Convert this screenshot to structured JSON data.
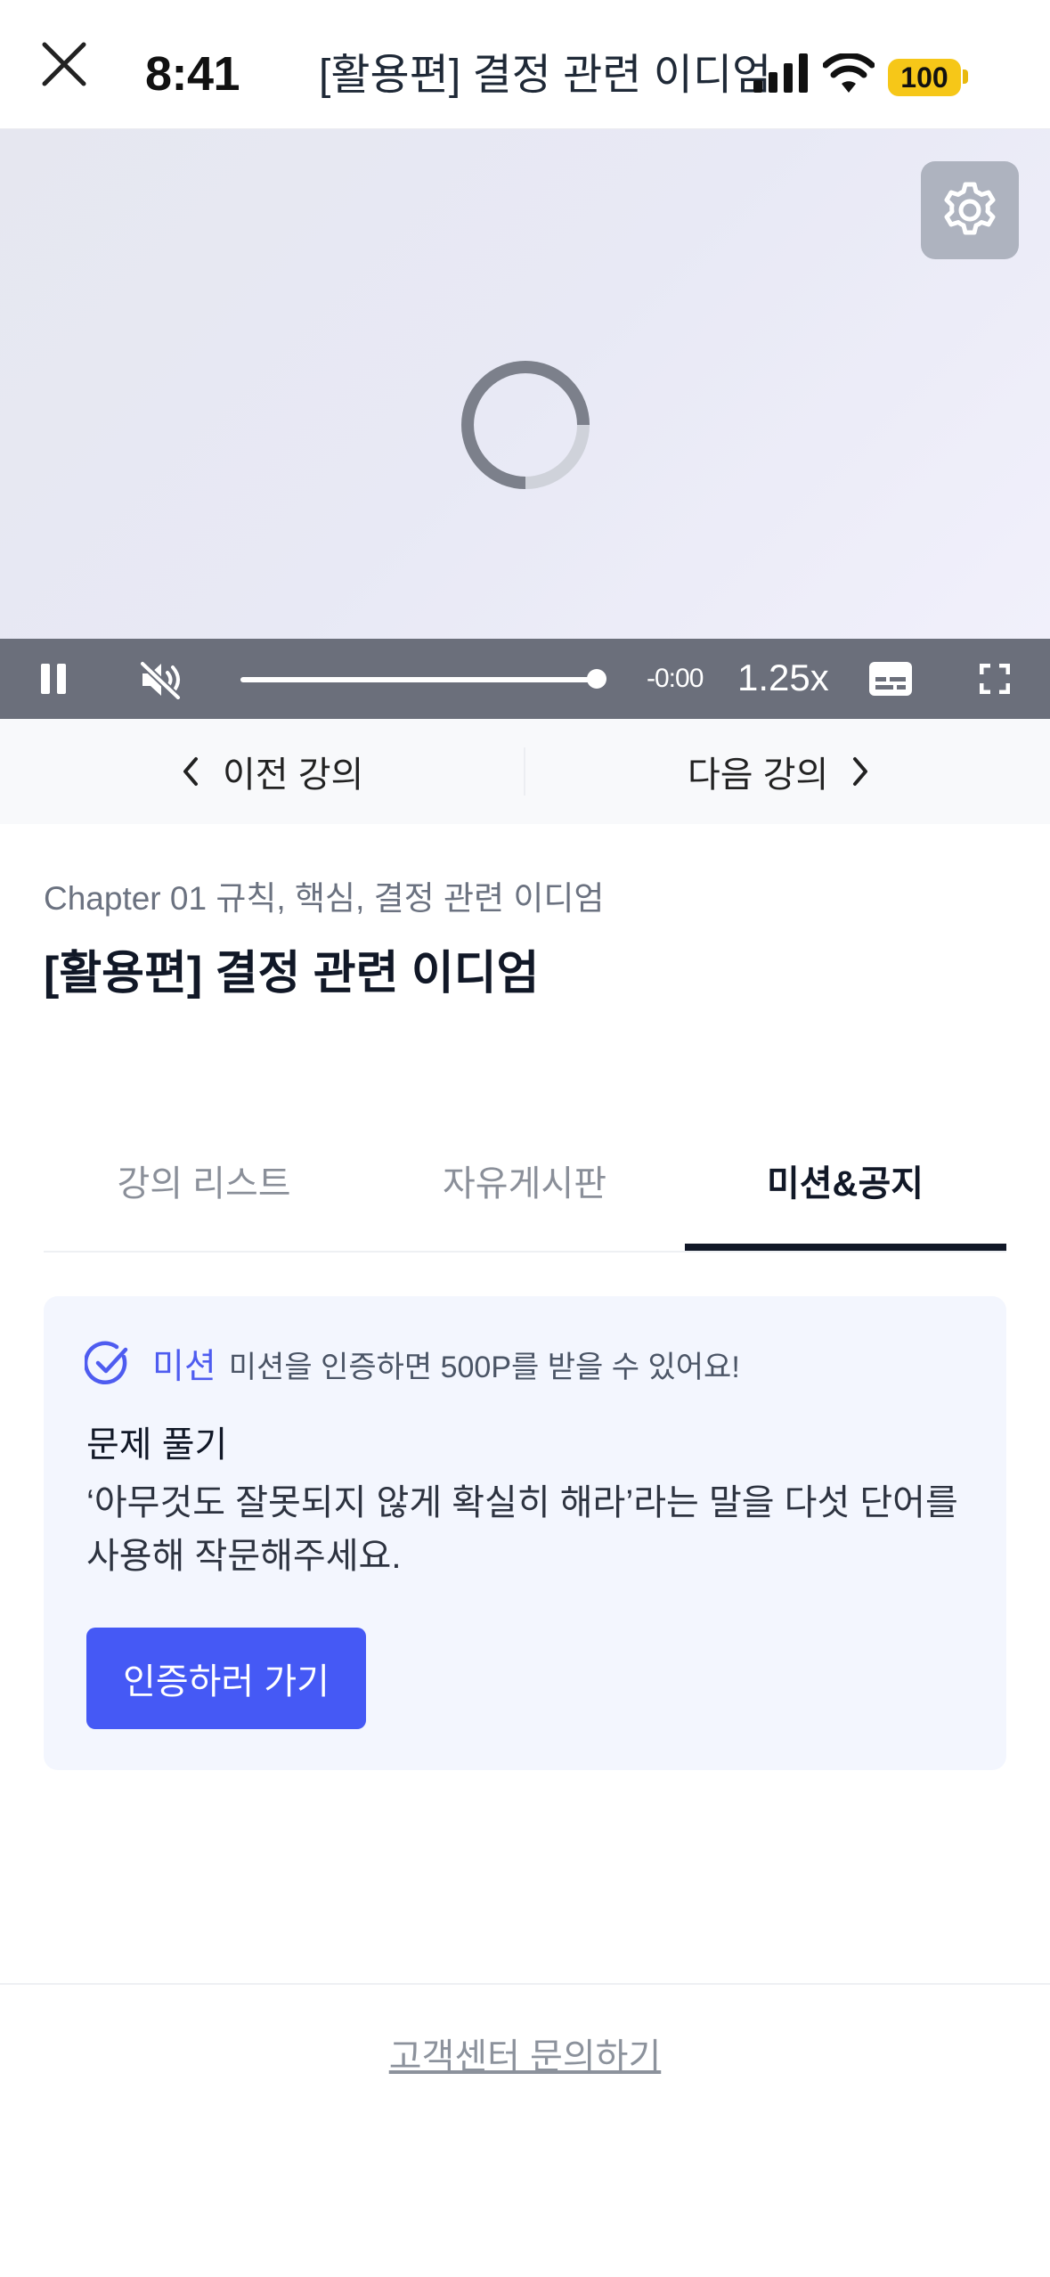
{
  "status_bar": {
    "time": "8:41",
    "battery": "100"
  },
  "header": {
    "title": "[활용편] 결정 관련 이디엄"
  },
  "player": {
    "remaining_time": "-0:00",
    "speed": "1.25x",
    "progress": 1.0
  },
  "nav": {
    "prev_label": "이전 강의",
    "next_label": "다음 강의"
  },
  "lecture": {
    "chapter": "Chapter 01 규칙, 핵심, 결정 관련 이디엄",
    "title": "[활용편] 결정 관련 이디엄"
  },
  "tabs": [
    {
      "label": "강의 리스트",
      "active": false
    },
    {
      "label": "자유게시판",
      "active": false
    },
    {
      "label": "미션&공지",
      "active": true
    }
  ],
  "mission": {
    "label": "미션",
    "description": "미션을 인증하면 500P를 받을 수 있어요!",
    "problem_title": "문제 풀기",
    "problem_text": "‘아무것도 잘못되지 않게 확실히 해라’라는 말을 다섯 단어를 사용해 작문해주세요.",
    "button_label": "인증하러 가기"
  },
  "footer": {
    "support_label": "고객센터 문의하기"
  },
  "colors": {
    "accent": "#4559f5",
    "battery": "#f6c718",
    "controls_bg": "#6b6f7b"
  }
}
